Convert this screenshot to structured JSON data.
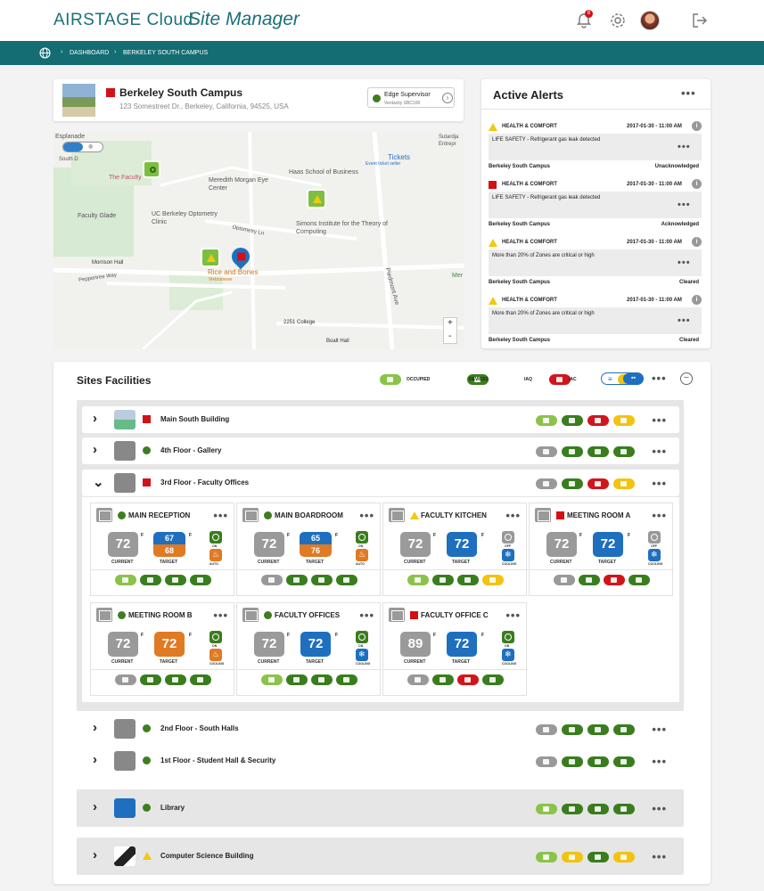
{
  "header": {
    "brand": "AIRSTAGE Cloud",
    "product": "Site Manager",
    "notif_count": "8"
  },
  "breadcrumb": {
    "items": [
      "DASHBOARD",
      "BERKELEY SOUTH CAMPUS"
    ]
  },
  "site": {
    "name": "Berkeley South Campus",
    "address": "123 Somestreet Dr., Berkeley, California, 94525, USA",
    "supervisor": "Edge Supervisor",
    "supervisor_model": "Ventacity SBC100"
  },
  "map": {
    "labels": [
      "Esplanade",
      "South D",
      "The Faculty",
      "Meredith Morgan Eye Center",
      "Haas School of Business",
      "Tickets",
      "Event ticket seller",
      "Sutardja Entrepr",
      "Faculty Glade",
      "UC Berkeley Optometry Clinic",
      "Simons Institute for the Theory of Computing",
      "Optometry Ln",
      "Morrison Hall",
      "Peppertree Way",
      "Rice and Bones",
      "Vietnamese",
      "Piedmont Ave",
      "2251 College",
      "Boalt Hall",
      "Mer"
    ],
    "zoom_in": "+",
    "zoom_out": "-"
  },
  "alerts": {
    "title": "Active Alerts",
    "items": [
      {
        "cat": "HEALTH & COMFORT",
        "time": "2017-01-30 - 11:00 AM",
        "msg": "LIFE SAFETY - Refrigerant gas leak detected",
        "site": "Berkeley South Campus",
        "status": "Unacknowledged"
      },
      {
        "cat": "HEALTH & COMFORT",
        "time": "2017-01-30 - 11:00 AM",
        "msg": "LIFE SAFETY - Refrigerant gas leak detected",
        "site": "Berkeley South Campus",
        "status": "Acknowledged"
      },
      {
        "cat": "HEALTH & COMFORT",
        "time": "2017-01-30 - 11:00 AM",
        "msg": "More than 20% of Zones are critical or high",
        "site": "Berkeley South Campus",
        "status": "Cleared"
      },
      {
        "cat": "HEALTH & COMFORT",
        "time": "2017-01-30 - 11:00 AM",
        "msg": "More than 20% of Zones are critical or high",
        "site": "Berkeley South Campus",
        "status": "Cleared"
      }
    ]
  },
  "facilities": {
    "title": "Sites Facilities",
    "legend": [
      "OCCUPIED",
      "DEVICES",
      "IAQ",
      "IAC"
    ],
    "rows": [
      {
        "name": "Main South Building"
      },
      {
        "name": "4th Floor - Gallery"
      },
      {
        "name": "3rd Floor - Faculty Offices"
      },
      {
        "name": "2nd Floor - South Halls"
      },
      {
        "name": "1st Floor - Student Hall & Security"
      },
      {
        "name": "Library"
      },
      {
        "name": "Computer Science Building"
      }
    ],
    "zones": [
      {
        "name": "MAIN RECEPTION",
        "current": "72",
        "target_hi": "67",
        "target_lo": "68",
        "mode": "AUTO"
      },
      {
        "name": "MAIN BOARDROOM",
        "current": "72",
        "target_hi": "65",
        "target_lo": "76",
        "mode": "AUTO"
      },
      {
        "name": "FACULTY KITCHEN",
        "current": "72",
        "target": "72",
        "mode": "COOLING"
      },
      {
        "name": "MEETING ROOM A",
        "current": "72",
        "target": "72",
        "mode": "COOLING"
      },
      {
        "name": "MEETING ROOM B",
        "current": "72",
        "target": "72",
        "mode": "COOLING"
      },
      {
        "name": "FACULTY OFFICES",
        "current": "72",
        "target": "72",
        "mode": "COOLING"
      },
      {
        "name": "FACULTY OFFICE C",
        "current": "89",
        "target": "72",
        "mode": "COOLING"
      }
    ],
    "labels": {
      "current": "CURRENT",
      "target": "TARGET",
      "unit": "F",
      "on": "ON",
      "off": "OFF"
    }
  }
}
